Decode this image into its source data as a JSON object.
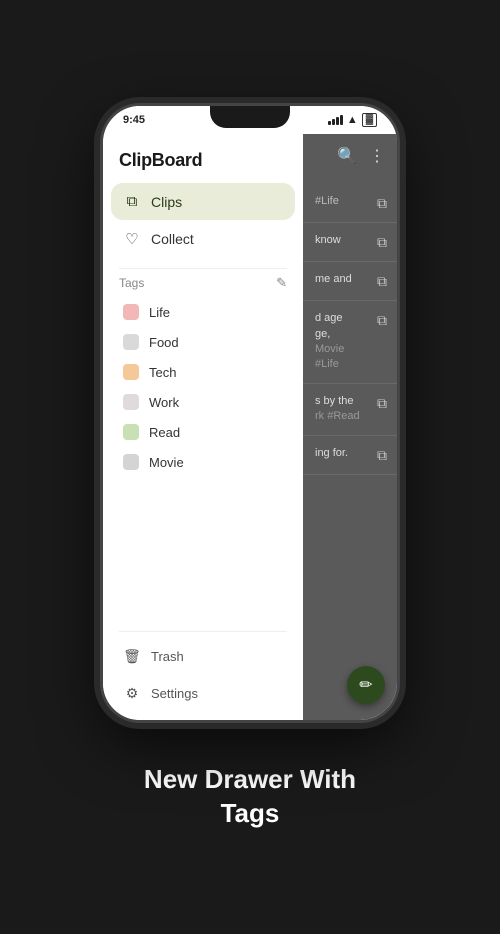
{
  "status": {
    "time": "9:45",
    "signal": "signal-icon",
    "wifi": "wifi-icon",
    "battery": "battery-icon"
  },
  "app": {
    "title": "ClipBoard"
  },
  "nav": {
    "clips_label": "Clips",
    "collect_label": "Collect"
  },
  "tags": {
    "section_label": "Tags",
    "edit_icon": "✎",
    "items": [
      {
        "name": "Life",
        "color": "#f2b8b8"
      },
      {
        "name": "Food",
        "color": "#d9d9d9"
      },
      {
        "name": "Tech",
        "color": "#f5c89a"
      },
      {
        "name": "Work",
        "color": "#e0dada"
      },
      {
        "name": "Read",
        "color": "#c8e0b4"
      },
      {
        "name": "Movie",
        "color": "#d4d4d4"
      }
    ]
  },
  "footer": {
    "trash_label": "Trash",
    "settings_label": "Settings"
  },
  "clips": [
    {
      "text": "#Life",
      "snippet": ""
    },
    {
      "text": "know",
      "snippet": ""
    },
    {
      "text": "me and",
      "snippet": ""
    },
    {
      "text": "d age\nge,\nMovie #Life",
      "snippet": ""
    },
    {
      "text": "s by the\nrk #Read",
      "snippet": ""
    },
    {
      "text": "ing for.",
      "snippet": ""
    }
  ],
  "fab": {
    "icon": "✏",
    "color": "#2d4a1e"
  },
  "bottom_caption": "New Drawer With\nTags"
}
